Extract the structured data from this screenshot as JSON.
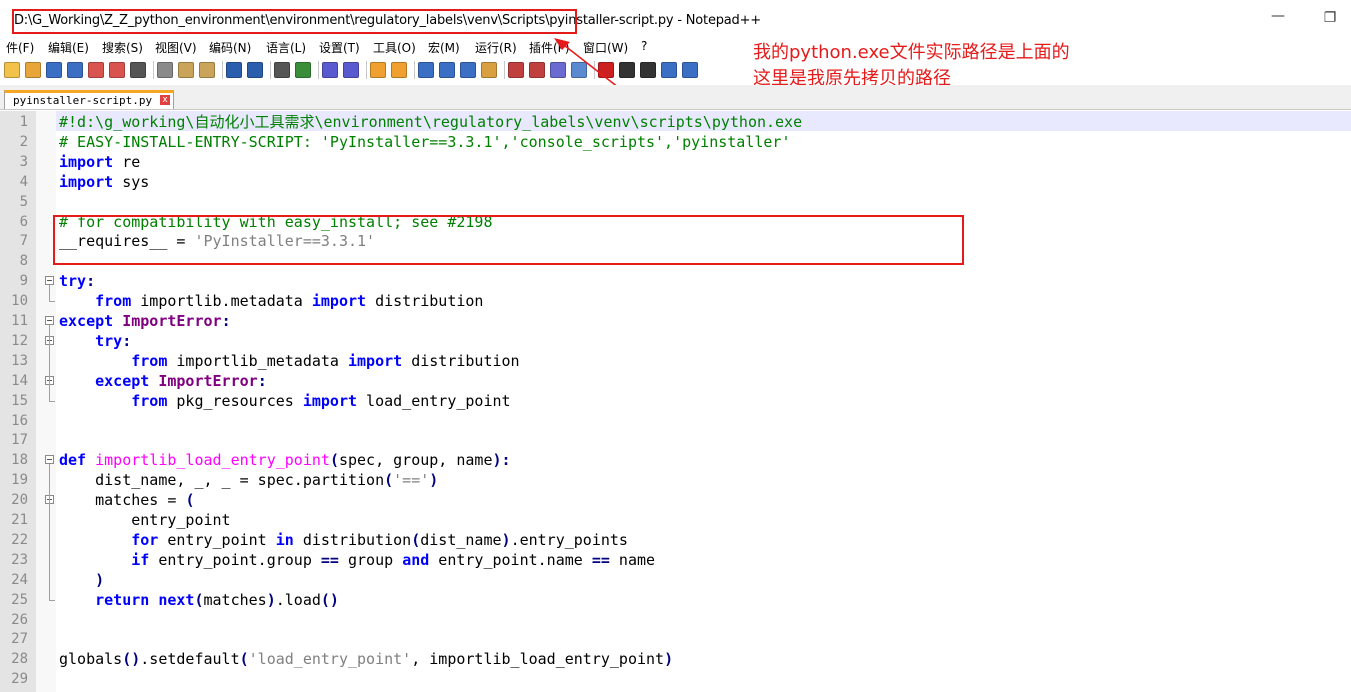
{
  "window": {
    "title": "D:\\G_Working\\Z_Z_python_environment\\environment\\regulatory_labels\\venv\\Scripts\\pyinstaller-script.py - Notepad++",
    "minimize_glyph": "—",
    "restore_glyph": "❐"
  },
  "menu": [
    "件(F)",
    "编辑(E)",
    "搜索(S)",
    "视图(V)",
    "编码(N)",
    "语言(L)",
    "设置(T)",
    "工具(O)",
    "宏(M)",
    "运行(R)",
    "插件(P)",
    "窗口(W)",
    "?"
  ],
  "annotation": {
    "line1": "我的python.exe文件实际路径是上面的",
    "line2": "这里是我原先拷贝的路径",
    "color": "#e51a1a"
  },
  "tab": {
    "label": "pyinstaller-script.py",
    "close_glyph": "x"
  },
  "editor": {
    "line_numbers": [
      "1",
      "2",
      "3",
      "4",
      "5",
      "6",
      "7",
      "8",
      "9",
      "10",
      "11",
      "12",
      "13",
      "14",
      "15",
      "16",
      "17",
      "18",
      "19",
      "20",
      "21",
      "22",
      "23",
      "24",
      "25",
      "26",
      "27",
      "28",
      "29"
    ],
    "lines": [
      [
        {
          "t": "#!d:\\g_working\\自动化小工具需求\\environment\\regulatory_labels\\venv\\scripts\\python.exe",
          "c": "c"
        }
      ],
      [
        {
          "t": "# EASY-INSTALL-ENTRY-SCRIPT: 'PyInstaller==3.3.1','console_scripts','pyinstaller'",
          "c": "c"
        }
      ],
      [
        {
          "t": "import",
          "c": "k"
        },
        {
          "t": " re",
          "c": ""
        }
      ],
      [
        {
          "t": "import",
          "c": "k"
        },
        {
          "t": " sys",
          "c": ""
        }
      ],
      [],
      [
        {
          "t": "# for compatibility with easy_install; see #2198",
          "c": "c"
        }
      ],
      [
        {
          "t": "__requires__ = ",
          "c": ""
        },
        {
          "t": "'PyInstaller==3.3.1'",
          "c": "s"
        }
      ],
      [],
      [
        {
          "t": "try",
          "c": "k"
        },
        {
          "t": ":",
          "c": "o"
        }
      ],
      [
        {
          "t": "    ",
          "c": ""
        },
        {
          "t": "from",
          "c": "k"
        },
        {
          "t": " importlib.metadata ",
          "c": ""
        },
        {
          "t": "import",
          "c": "k"
        },
        {
          "t": " distribution",
          "c": ""
        }
      ],
      [
        {
          "t": "except",
          "c": "k"
        },
        {
          "t": " ",
          "c": ""
        },
        {
          "t": "ImportError",
          "c": "x"
        },
        {
          "t": ":",
          "c": "o"
        }
      ],
      [
        {
          "t": "    ",
          "c": ""
        },
        {
          "t": "try",
          "c": "k"
        },
        {
          "t": ":",
          "c": "o"
        }
      ],
      [
        {
          "t": "        ",
          "c": ""
        },
        {
          "t": "from",
          "c": "k"
        },
        {
          "t": " importlib_metadata ",
          "c": ""
        },
        {
          "t": "import",
          "c": "k"
        },
        {
          "t": " distribution",
          "c": ""
        }
      ],
      [
        {
          "t": "    ",
          "c": ""
        },
        {
          "t": "except",
          "c": "k"
        },
        {
          "t": " ",
          "c": ""
        },
        {
          "t": "ImportError",
          "c": "x"
        },
        {
          "t": ":",
          "c": "o"
        }
      ],
      [
        {
          "t": "        ",
          "c": ""
        },
        {
          "t": "from",
          "c": "k"
        },
        {
          "t": " pkg_resources ",
          "c": ""
        },
        {
          "t": "import",
          "c": "k"
        },
        {
          "t": " load_entry_point",
          "c": ""
        }
      ],
      [],
      [],
      [
        {
          "t": "def",
          "c": "k"
        },
        {
          "t": " ",
          "c": ""
        },
        {
          "t": "importlib_load_entry_point",
          "c": "f"
        },
        {
          "t": "(",
          "c": "o"
        },
        {
          "t": "spec, group, name",
          "c": ""
        },
        {
          "t": "):",
          "c": "o"
        }
      ],
      [
        {
          "t": "    dist_name, _, _ = spec.partition",
          "c": ""
        },
        {
          "t": "(",
          "c": "o"
        },
        {
          "t": "'=='",
          "c": "s"
        },
        {
          "t": ")",
          "c": "o"
        }
      ],
      [
        {
          "t": "    matches = ",
          "c": ""
        },
        {
          "t": "(",
          "c": "o"
        }
      ],
      [
        {
          "t": "        entry_point",
          "c": ""
        }
      ],
      [
        {
          "t": "        ",
          "c": ""
        },
        {
          "t": "for",
          "c": "k"
        },
        {
          "t": " entry_point ",
          "c": ""
        },
        {
          "t": "in",
          "c": "k"
        },
        {
          "t": " distribution",
          "c": ""
        },
        {
          "t": "(",
          "c": "o"
        },
        {
          "t": "dist_name",
          "c": ""
        },
        {
          "t": ")",
          "c": "o"
        },
        {
          "t": ".entry_points",
          "c": ""
        }
      ],
      [
        {
          "t": "        ",
          "c": ""
        },
        {
          "t": "if",
          "c": "k"
        },
        {
          "t": " entry_point.group ",
          "c": ""
        },
        {
          "t": "==",
          "c": "o"
        },
        {
          "t": " group ",
          "c": ""
        },
        {
          "t": "and",
          "c": "k"
        },
        {
          "t": " entry_point.name ",
          "c": ""
        },
        {
          "t": "==",
          "c": "o"
        },
        {
          "t": " name",
          "c": ""
        }
      ],
      [
        {
          "t": "    ",
          "c": ""
        },
        {
          "t": ")",
          "c": "o"
        }
      ],
      [
        {
          "t": "    ",
          "c": ""
        },
        {
          "t": "return",
          "c": "k"
        },
        {
          "t": " ",
          "c": ""
        },
        {
          "t": "next",
          "c": "k"
        },
        {
          "t": "(",
          "c": "o"
        },
        {
          "t": "matches",
          "c": ""
        },
        {
          "t": ")",
          "c": "o"
        },
        {
          "t": ".load",
          "c": ""
        },
        {
          "t": "()",
          "c": "o"
        }
      ],
      [],
      [],
      [
        {
          "t": "globals",
          "c": ""
        },
        {
          "t": "()",
          "c": "o"
        },
        {
          "t": ".setdefault",
          "c": ""
        },
        {
          "t": "(",
          "c": "o"
        },
        {
          "t": "'load_entry_point'",
          "c": "s"
        },
        {
          "t": ", importlib_load_entry_point",
          "c": ""
        },
        {
          "t": ")",
          "c": "o"
        }
      ],
      []
    ]
  },
  "toolbar_icons": [
    "new-file-icon",
    "open-file-icon",
    "save-icon",
    "save-all-icon",
    "close-icon",
    "close-all-icon",
    "print-icon",
    "cut-icon",
    "copy-icon",
    "paste-icon",
    "undo-icon",
    "redo-icon",
    "find-icon",
    "replace-icon",
    "zoom-in-icon",
    "zoom-out-icon",
    "sync-vertical-icon",
    "sync-horizontal-icon",
    "word-wrap-icon",
    "show-all-chars-icon",
    "indent-guide-icon",
    "udl-icon",
    "doc-map-icon",
    "function-list-icon",
    "folder-workspace-icon",
    "monitoring-icon",
    "record-macro-icon",
    "stop-record-icon",
    "play-macro-icon",
    "run-macro-multiple-icon",
    "save-macro-icon"
  ]
}
